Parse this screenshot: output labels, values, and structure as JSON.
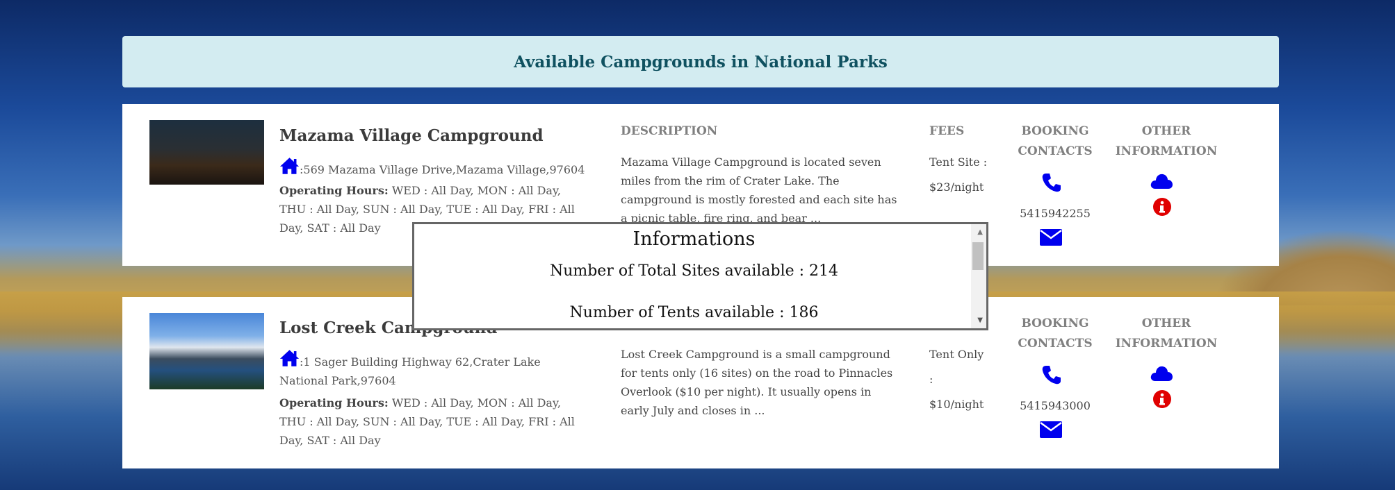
{
  "header": {
    "title": "Available Campgrounds in National Parks"
  },
  "colors": {
    "icon_blue": "#0000ee",
    "info_red": "#e00000",
    "header_bg": "#d3ecf1",
    "header_text": "#0f5160"
  },
  "icons": {
    "home": "home-icon",
    "phone": "phone-icon",
    "mail": "envelope-icon",
    "cloud": "cloud-icon",
    "info": "info-circle-icon"
  },
  "columns": {
    "description": "DESCRIPTION",
    "fees": "FEES",
    "booking_1": "BOOKING",
    "booking_2": "CONTACTS",
    "other_1": "OTHER",
    "other_2": "INFORMATION"
  },
  "hours_label": "Operating Hours:",
  "campgrounds": [
    {
      "name": "Mazama Village Campground",
      "address": ":569 Mazama Village Drive,Mazama Village,97604",
      "hours": " WED : All Day, MON : All Day, THU : All Day, SUN : All Day, TUE : All Day, FRI : All Day, SAT : All Day",
      "description": "Mazama Village Campground is located seven miles from the rim of Crater Lake. The campground is mostly forested and each site has a picnic table, fire ring, and bear ...",
      "fees_1": "Tent Site :",
      "fees_2": "$23/night",
      "phone": "5415942255"
    },
    {
      "name": "Lost Creek Campground",
      "address": ":1 Sager Building Highway 62,Crater Lake National Park,97604",
      "hours": " WED : All Day, MON : All Day, THU : All Day, SUN : All Day, TUE : All Day, FRI : All Day, SAT : All Day",
      "description": "Lost Creek Campground is a small campground for tents only (16 sites) on the road to Pinnacles Overlook ($10 per night). It usually opens in early July and closes in ...",
      "fees_1": "Tent Only",
      "fees_2": ":",
      "fees_3": "$10/night",
      "phone": "5415943000"
    }
  ],
  "popup": {
    "title": "Informations",
    "total_sites": "Number of Total Sites available : 214",
    "tents": "Number of Tents available : 186"
  }
}
